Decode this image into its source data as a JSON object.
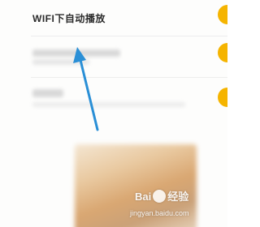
{
  "settings": {
    "wifi_autoplay_title": "WIFI下自动播放"
  },
  "colors": {
    "toggle_accent": "#f5b400",
    "annotation_arrow": "#2a8fd6"
  },
  "watermark": {
    "logo_text_left": "Bai",
    "logo_text_right": "经验",
    "url": "jingyan.baidu.com"
  }
}
